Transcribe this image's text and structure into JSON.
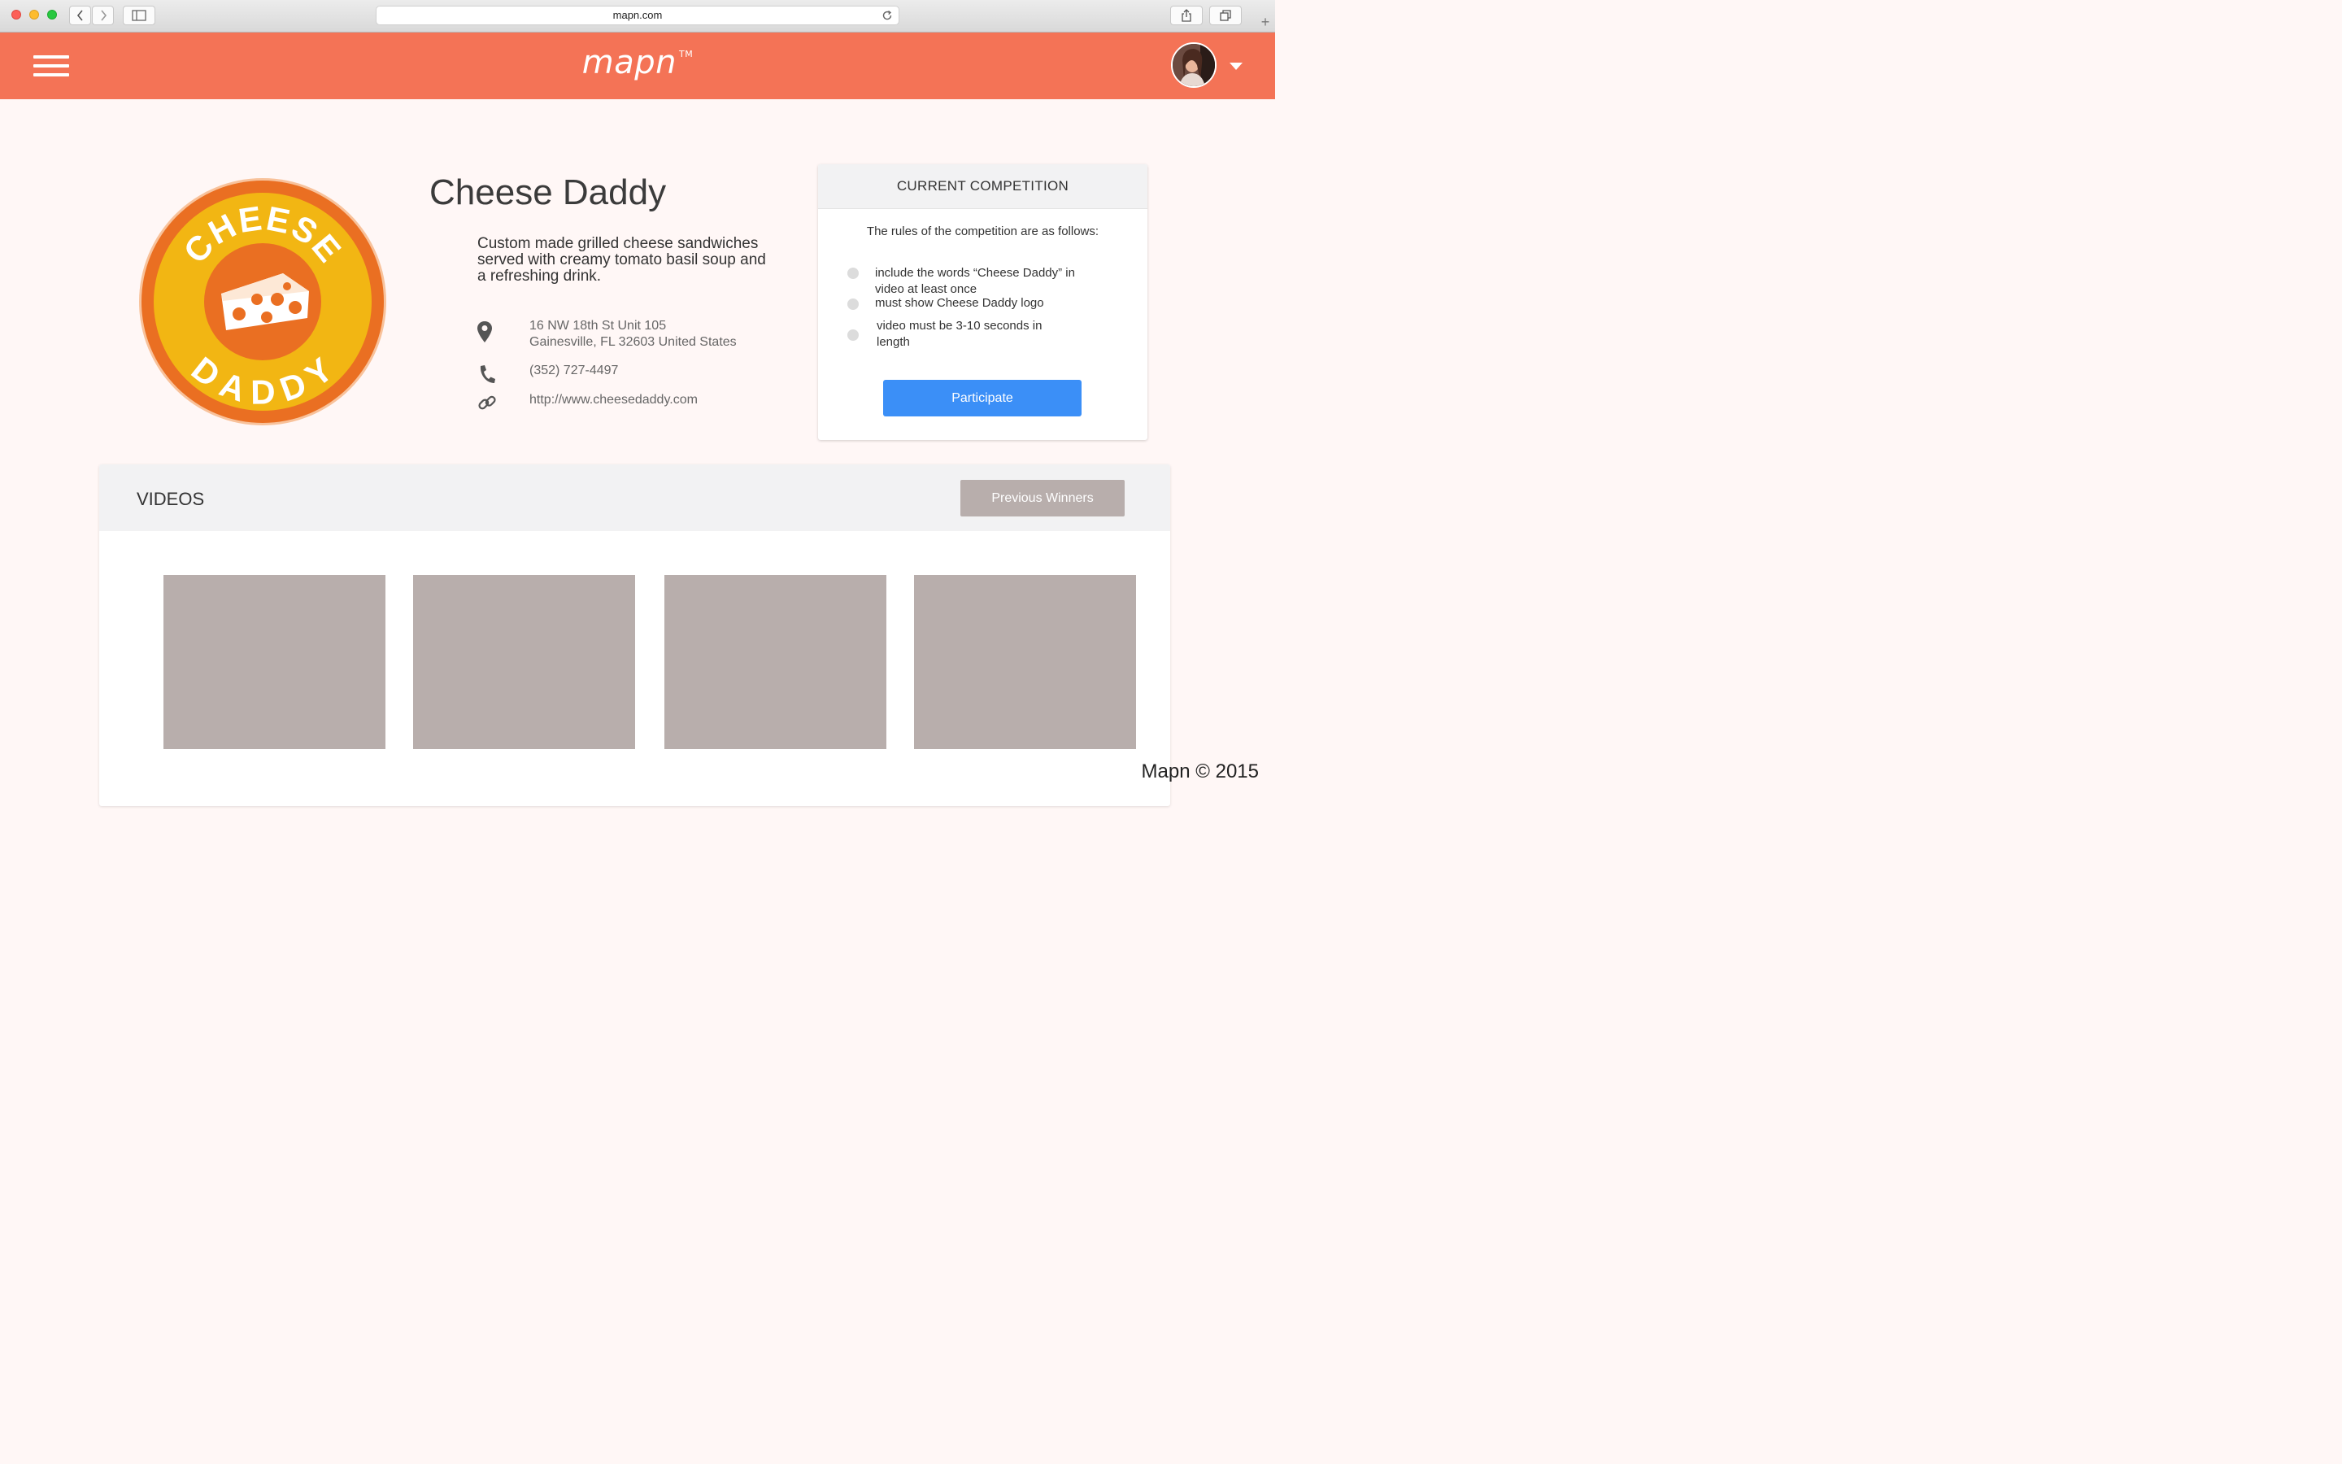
{
  "browser": {
    "url": "mapn.com"
  },
  "header": {
    "logo": "mapn",
    "trademark": "TM",
    "accent_color": "#f47356"
  },
  "business": {
    "name": "Cheese Daddy",
    "badge_top_text": "CHEESE",
    "badge_bottom_text": "DADDY",
    "description": "Custom made grilled cheese sandwiches served with creamy tomato basil soup and a refreshing drink.",
    "address_line1": "16 NW 18th St Unit 105",
    "address_line2": "Gainesville, FL 32603 United States",
    "phone": "(352) 727-4497",
    "website": "http://www.cheesedaddy.com"
  },
  "competition": {
    "title": "CURRENT COMPETITION",
    "intro": "The rules of the competition are as follows:",
    "rules": [
      "include the words “Cheese Daddy” in video at least once",
      "must show Cheese Daddy logo",
      "video must be 3-10 seconds in length"
    ],
    "participate_label": "Participate",
    "button_color": "#3b8ff7"
  },
  "videos": {
    "title": "VIDEOS",
    "previous_winners_label": "Previous Winners"
  },
  "footer": {
    "copyright": "Mapn © 2015"
  }
}
